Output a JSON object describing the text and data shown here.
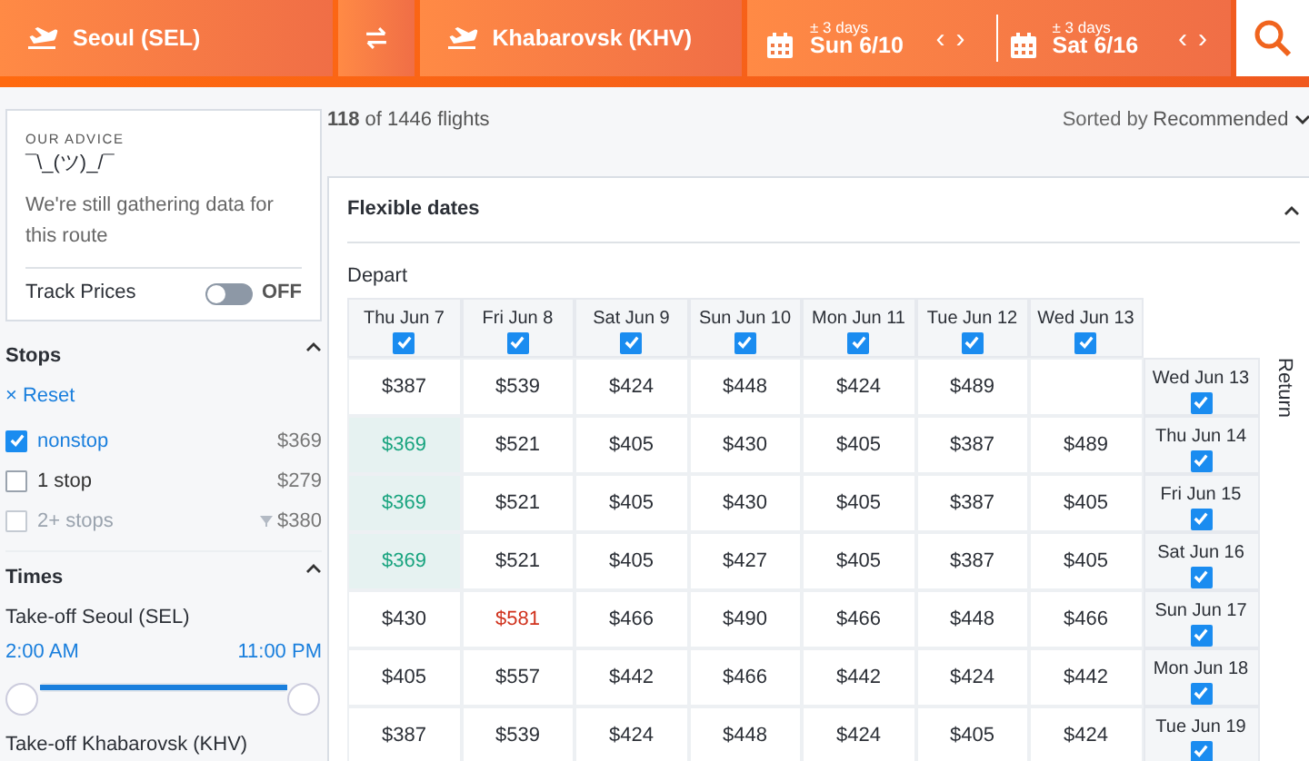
{
  "search_bar": {
    "origin": "Seoul (SEL)",
    "destination": "Khabarovsk (KHV)",
    "dates": [
      {
        "flex": "± 3 days",
        "date": "Sun 6/10",
        "prev": "‹",
        "next": "›"
      },
      {
        "flex": "± 3 days",
        "date": "Sat 6/16",
        "prev": "‹",
        "next": "›"
      }
    ]
  },
  "advice": {
    "heading": "OUR ADVICE",
    "shrug": "¯\\_(ツ)_/¯",
    "message": "We're still gathering data for this route",
    "track_label": "Track Prices",
    "track_on": false,
    "track_state": "OFF"
  },
  "stops": {
    "title": "Stops",
    "reset": "× Reset",
    "items": [
      {
        "label": "nonstop",
        "price": "$369",
        "checked": true,
        "disabled": false
      },
      {
        "label": "1 stop",
        "price": "$279",
        "checked": false,
        "disabled": false
      },
      {
        "label": "2+ stops",
        "price": "$380",
        "checked": false,
        "disabled": true
      }
    ]
  },
  "times": {
    "title": "Times",
    "groups": [
      {
        "label": "Take-off Seoul (SEL)",
        "from": "2:00 AM",
        "to": "11:00 PM",
        "level": 1
      },
      {
        "label": "Take-off Khabarovsk (KHV)"
      }
    ]
  },
  "results": {
    "count": "118",
    "total_text": "of 1446 flights",
    "sort_label": "Sorted by",
    "sort_value": "Recommended"
  },
  "flexible": {
    "title": "Flexible dates",
    "depart_label": "Depart",
    "return_label": "Return",
    "depart_dates": [
      {
        "label": "Thu Jun 7",
        "checked": true
      },
      {
        "label": "Fri Jun 8",
        "checked": true
      },
      {
        "label": "Sat Jun 9",
        "checked": true
      },
      {
        "label": "Sun Jun 10",
        "checked": true
      },
      {
        "label": "Mon Jun 11",
        "checked": true
      },
      {
        "label": "Tue Jun 12",
        "checked": true
      },
      {
        "label": "Wed Jun 13",
        "checked": true
      }
    ],
    "rows": [
      {
        "return_date": "Wed Jun 13",
        "checked": true,
        "cells": [
          {
            "price": "$387",
            "lowest": false,
            "highest": false
          },
          {
            "price": "$539",
            "lowest": false,
            "highest": false
          },
          {
            "price": "$424",
            "lowest": false,
            "highest": false
          },
          {
            "price": "$448",
            "lowest": false,
            "highest": false
          },
          {
            "price": "$424",
            "lowest": false,
            "highest": false
          },
          {
            "price": "$489",
            "lowest": false,
            "highest": false
          },
          null
        ]
      },
      {
        "return_date": "Thu Jun 14",
        "checked": true,
        "cells": [
          {
            "price": "$369",
            "lowest": true,
            "highest": false
          },
          {
            "price": "$521",
            "lowest": false,
            "highest": false
          },
          {
            "price": "$405",
            "lowest": false,
            "highest": false
          },
          {
            "price": "$430",
            "lowest": false,
            "highest": false
          },
          {
            "price": "$405",
            "lowest": false,
            "highest": false
          },
          {
            "price": "$387",
            "lowest": false,
            "highest": false
          },
          {
            "price": "$489",
            "lowest": false,
            "highest": false
          }
        ]
      },
      {
        "return_date": "Fri Jun 15",
        "checked": true,
        "cells": [
          {
            "price": "$369",
            "lowest": true,
            "highest": false
          },
          {
            "price": "$521",
            "lowest": false,
            "highest": false
          },
          {
            "price": "$405",
            "lowest": false,
            "highest": false
          },
          {
            "price": "$430",
            "lowest": false,
            "highest": false
          },
          {
            "price": "$405",
            "lowest": false,
            "highest": false
          },
          {
            "price": "$387",
            "lowest": false,
            "highest": false
          },
          {
            "price": "$405",
            "lowest": false,
            "highest": false
          }
        ]
      },
      {
        "return_date": "Sat Jun 16",
        "checked": true,
        "cells": [
          {
            "price": "$369",
            "lowest": true,
            "highest": false
          },
          {
            "price": "$521",
            "lowest": false,
            "highest": false
          },
          {
            "price": "$405",
            "lowest": false,
            "highest": false
          },
          {
            "price": "$427",
            "lowest": false,
            "highest": false
          },
          {
            "price": "$405",
            "lowest": false,
            "highest": false
          },
          {
            "price": "$387",
            "lowest": false,
            "highest": false
          },
          {
            "price": "$405",
            "lowest": false,
            "highest": false
          }
        ]
      },
      {
        "return_date": "Sun Jun 17",
        "checked": true,
        "cells": [
          {
            "price": "$430",
            "lowest": false,
            "highest": false
          },
          {
            "price": "$581",
            "lowest": false,
            "highest": true
          },
          {
            "price": "$466",
            "lowest": false,
            "highest": false
          },
          {
            "price": "$490",
            "lowest": false,
            "highest": false
          },
          {
            "price": "$466",
            "lowest": false,
            "highest": false
          },
          {
            "price": "$448",
            "lowest": false,
            "highest": false
          },
          {
            "price": "$466",
            "lowest": false,
            "highest": false
          }
        ]
      },
      {
        "return_date": "Mon Jun 18",
        "checked": true,
        "cells": [
          {
            "price": "$405",
            "lowest": false,
            "highest": false
          },
          {
            "price": "$557",
            "lowest": false,
            "highest": false
          },
          {
            "price": "$442",
            "lowest": false,
            "highest": false
          },
          {
            "price": "$466",
            "lowest": false,
            "highest": false
          },
          {
            "price": "$442",
            "lowest": false,
            "highest": false
          },
          {
            "price": "$424",
            "lowest": false,
            "highest": false
          },
          {
            "price": "$442",
            "lowest": false,
            "highest": false
          }
        ]
      },
      {
        "return_date": "Tue Jun 19",
        "checked": true,
        "cells": [
          {
            "price": "$387",
            "lowest": false,
            "highest": false
          },
          {
            "price": "$539",
            "lowest": false,
            "highest": false
          },
          {
            "price": "$424",
            "lowest": false,
            "highest": false
          },
          {
            "price": "$448",
            "lowest": false,
            "highest": false
          },
          {
            "price": "$424",
            "lowest": false,
            "highest": false
          },
          {
            "price": "$405",
            "lowest": false,
            "highest": false
          },
          {
            "price": "$424",
            "lowest": false,
            "highest": false
          }
        ]
      }
    ]
  }
}
